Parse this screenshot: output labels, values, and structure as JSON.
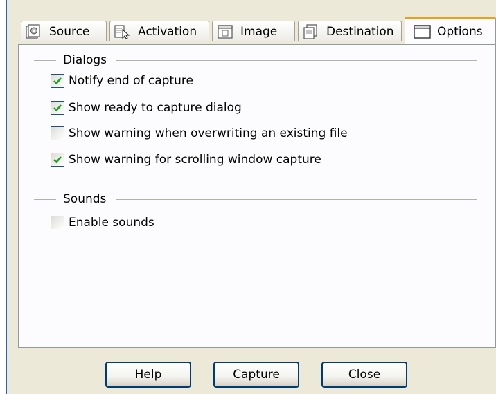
{
  "tabs": [
    {
      "label": "Source",
      "icon": "source-icon"
    },
    {
      "label": "Activation",
      "icon": "activation-icon"
    },
    {
      "label": "Image",
      "icon": "image-icon"
    },
    {
      "label": "Destination",
      "icon": "destination-icon"
    },
    {
      "label": "Options",
      "icon": "options-window-icon",
      "active": true
    }
  ],
  "dialogs": {
    "title": "Dialogs",
    "options": [
      {
        "label": "Notify end of capture",
        "checked": true
      },
      {
        "label": "Show ready to capture dialog",
        "checked": true
      },
      {
        "label": "Show warning when overwriting an existing file",
        "checked": false
      },
      {
        "label": "Show warning for scrolling window capture",
        "checked": true
      }
    ]
  },
  "sounds": {
    "title": "Sounds",
    "options": [
      {
        "label": "Enable sounds",
        "checked": false
      }
    ]
  },
  "buttons": {
    "help": "Help",
    "capture": "Capture",
    "close": "Close"
  },
  "colors": {
    "window_bg": "#ece9d8",
    "panel_bg": "#fcfcfe",
    "active_tab_accent": "#e8a219",
    "button_border": "#003c74",
    "check_mark": "#21a121"
  }
}
